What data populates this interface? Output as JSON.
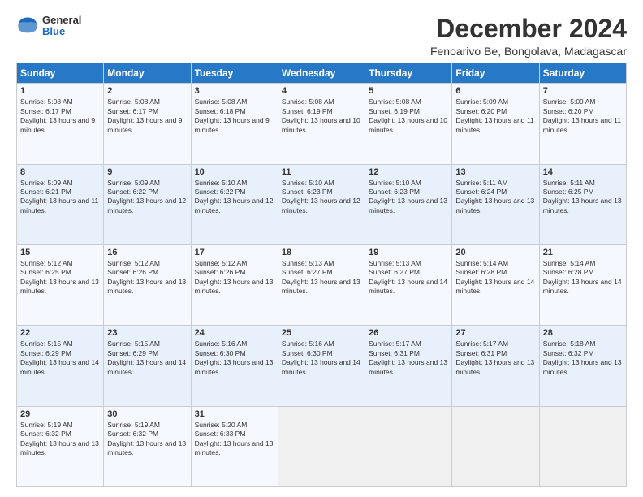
{
  "logo": {
    "general": "General",
    "blue": "Blue"
  },
  "title": "December 2024",
  "subtitle": "Fenoarivo Be, Bongolava, Madagascar",
  "headers": [
    "Sunday",
    "Monday",
    "Tuesday",
    "Wednesday",
    "Thursday",
    "Friday",
    "Saturday"
  ],
  "weeks": [
    [
      {
        "day": "1",
        "sunrise": "5:08 AM",
        "sunset": "6:17 PM",
        "daylight": "13 hours and 9 minutes."
      },
      {
        "day": "2",
        "sunrise": "5:08 AM",
        "sunset": "6:17 PM",
        "daylight": "13 hours and 9 minutes."
      },
      {
        "day": "3",
        "sunrise": "5:08 AM",
        "sunset": "6:18 PM",
        "daylight": "13 hours and 9 minutes."
      },
      {
        "day": "4",
        "sunrise": "5:08 AM",
        "sunset": "6:19 PM",
        "daylight": "13 hours and 10 minutes."
      },
      {
        "day": "5",
        "sunrise": "5:08 AM",
        "sunset": "6:19 PM",
        "daylight": "13 hours and 10 minutes."
      },
      {
        "day": "6",
        "sunrise": "5:09 AM",
        "sunset": "6:20 PM",
        "daylight": "13 hours and 11 minutes."
      },
      {
        "day": "7",
        "sunrise": "5:09 AM",
        "sunset": "6:20 PM",
        "daylight": "13 hours and 11 minutes."
      }
    ],
    [
      {
        "day": "8",
        "sunrise": "5:09 AM",
        "sunset": "6:21 PM",
        "daylight": "13 hours and 11 minutes."
      },
      {
        "day": "9",
        "sunrise": "5:09 AM",
        "sunset": "6:22 PM",
        "daylight": "13 hours and 12 minutes."
      },
      {
        "day": "10",
        "sunrise": "5:10 AM",
        "sunset": "6:22 PM",
        "daylight": "13 hours and 12 minutes."
      },
      {
        "day": "11",
        "sunrise": "5:10 AM",
        "sunset": "6:23 PM",
        "daylight": "13 hours and 12 minutes."
      },
      {
        "day": "12",
        "sunrise": "5:10 AM",
        "sunset": "6:23 PM",
        "daylight": "13 hours and 13 minutes."
      },
      {
        "day": "13",
        "sunrise": "5:11 AM",
        "sunset": "6:24 PM",
        "daylight": "13 hours and 13 minutes."
      },
      {
        "day": "14",
        "sunrise": "5:11 AM",
        "sunset": "6:25 PM",
        "daylight": "13 hours and 13 minutes."
      }
    ],
    [
      {
        "day": "15",
        "sunrise": "5:12 AM",
        "sunset": "6:25 PM",
        "daylight": "13 hours and 13 minutes."
      },
      {
        "day": "16",
        "sunrise": "5:12 AM",
        "sunset": "6:26 PM",
        "daylight": "13 hours and 13 minutes."
      },
      {
        "day": "17",
        "sunrise": "5:12 AM",
        "sunset": "6:26 PM",
        "daylight": "13 hours and 13 minutes."
      },
      {
        "day": "18",
        "sunrise": "5:13 AM",
        "sunset": "6:27 PM",
        "daylight": "13 hours and 13 minutes."
      },
      {
        "day": "19",
        "sunrise": "5:13 AM",
        "sunset": "6:27 PM",
        "daylight": "13 hours and 14 minutes."
      },
      {
        "day": "20",
        "sunrise": "5:14 AM",
        "sunset": "6:28 PM",
        "daylight": "13 hours and 14 minutes."
      },
      {
        "day": "21",
        "sunrise": "5:14 AM",
        "sunset": "6:28 PM",
        "daylight": "13 hours and 14 minutes."
      }
    ],
    [
      {
        "day": "22",
        "sunrise": "5:15 AM",
        "sunset": "6:29 PM",
        "daylight": "13 hours and 14 minutes."
      },
      {
        "day": "23",
        "sunrise": "5:15 AM",
        "sunset": "6:29 PM",
        "daylight": "13 hours and 14 minutes."
      },
      {
        "day": "24",
        "sunrise": "5:16 AM",
        "sunset": "6:30 PM",
        "daylight": "13 hours and 13 minutes."
      },
      {
        "day": "25",
        "sunrise": "5:16 AM",
        "sunset": "6:30 PM",
        "daylight": "13 hours and 14 minutes."
      },
      {
        "day": "26",
        "sunrise": "5:17 AM",
        "sunset": "6:31 PM",
        "daylight": "13 hours and 13 minutes."
      },
      {
        "day": "27",
        "sunrise": "5:17 AM",
        "sunset": "6:31 PM",
        "daylight": "13 hours and 13 minutes."
      },
      {
        "day": "28",
        "sunrise": "5:18 AM",
        "sunset": "6:32 PM",
        "daylight": "13 hours and 13 minutes."
      }
    ],
    [
      {
        "day": "29",
        "sunrise": "5:19 AM",
        "sunset": "6:32 PM",
        "daylight": "13 hours and 13 minutes."
      },
      {
        "day": "30",
        "sunrise": "5:19 AM",
        "sunset": "6:32 PM",
        "daylight": "13 hours and 13 minutes."
      },
      {
        "day": "31",
        "sunrise": "5:20 AM",
        "sunset": "6:33 PM",
        "daylight": "13 hours and 13 minutes."
      },
      null,
      null,
      null,
      null
    ]
  ]
}
